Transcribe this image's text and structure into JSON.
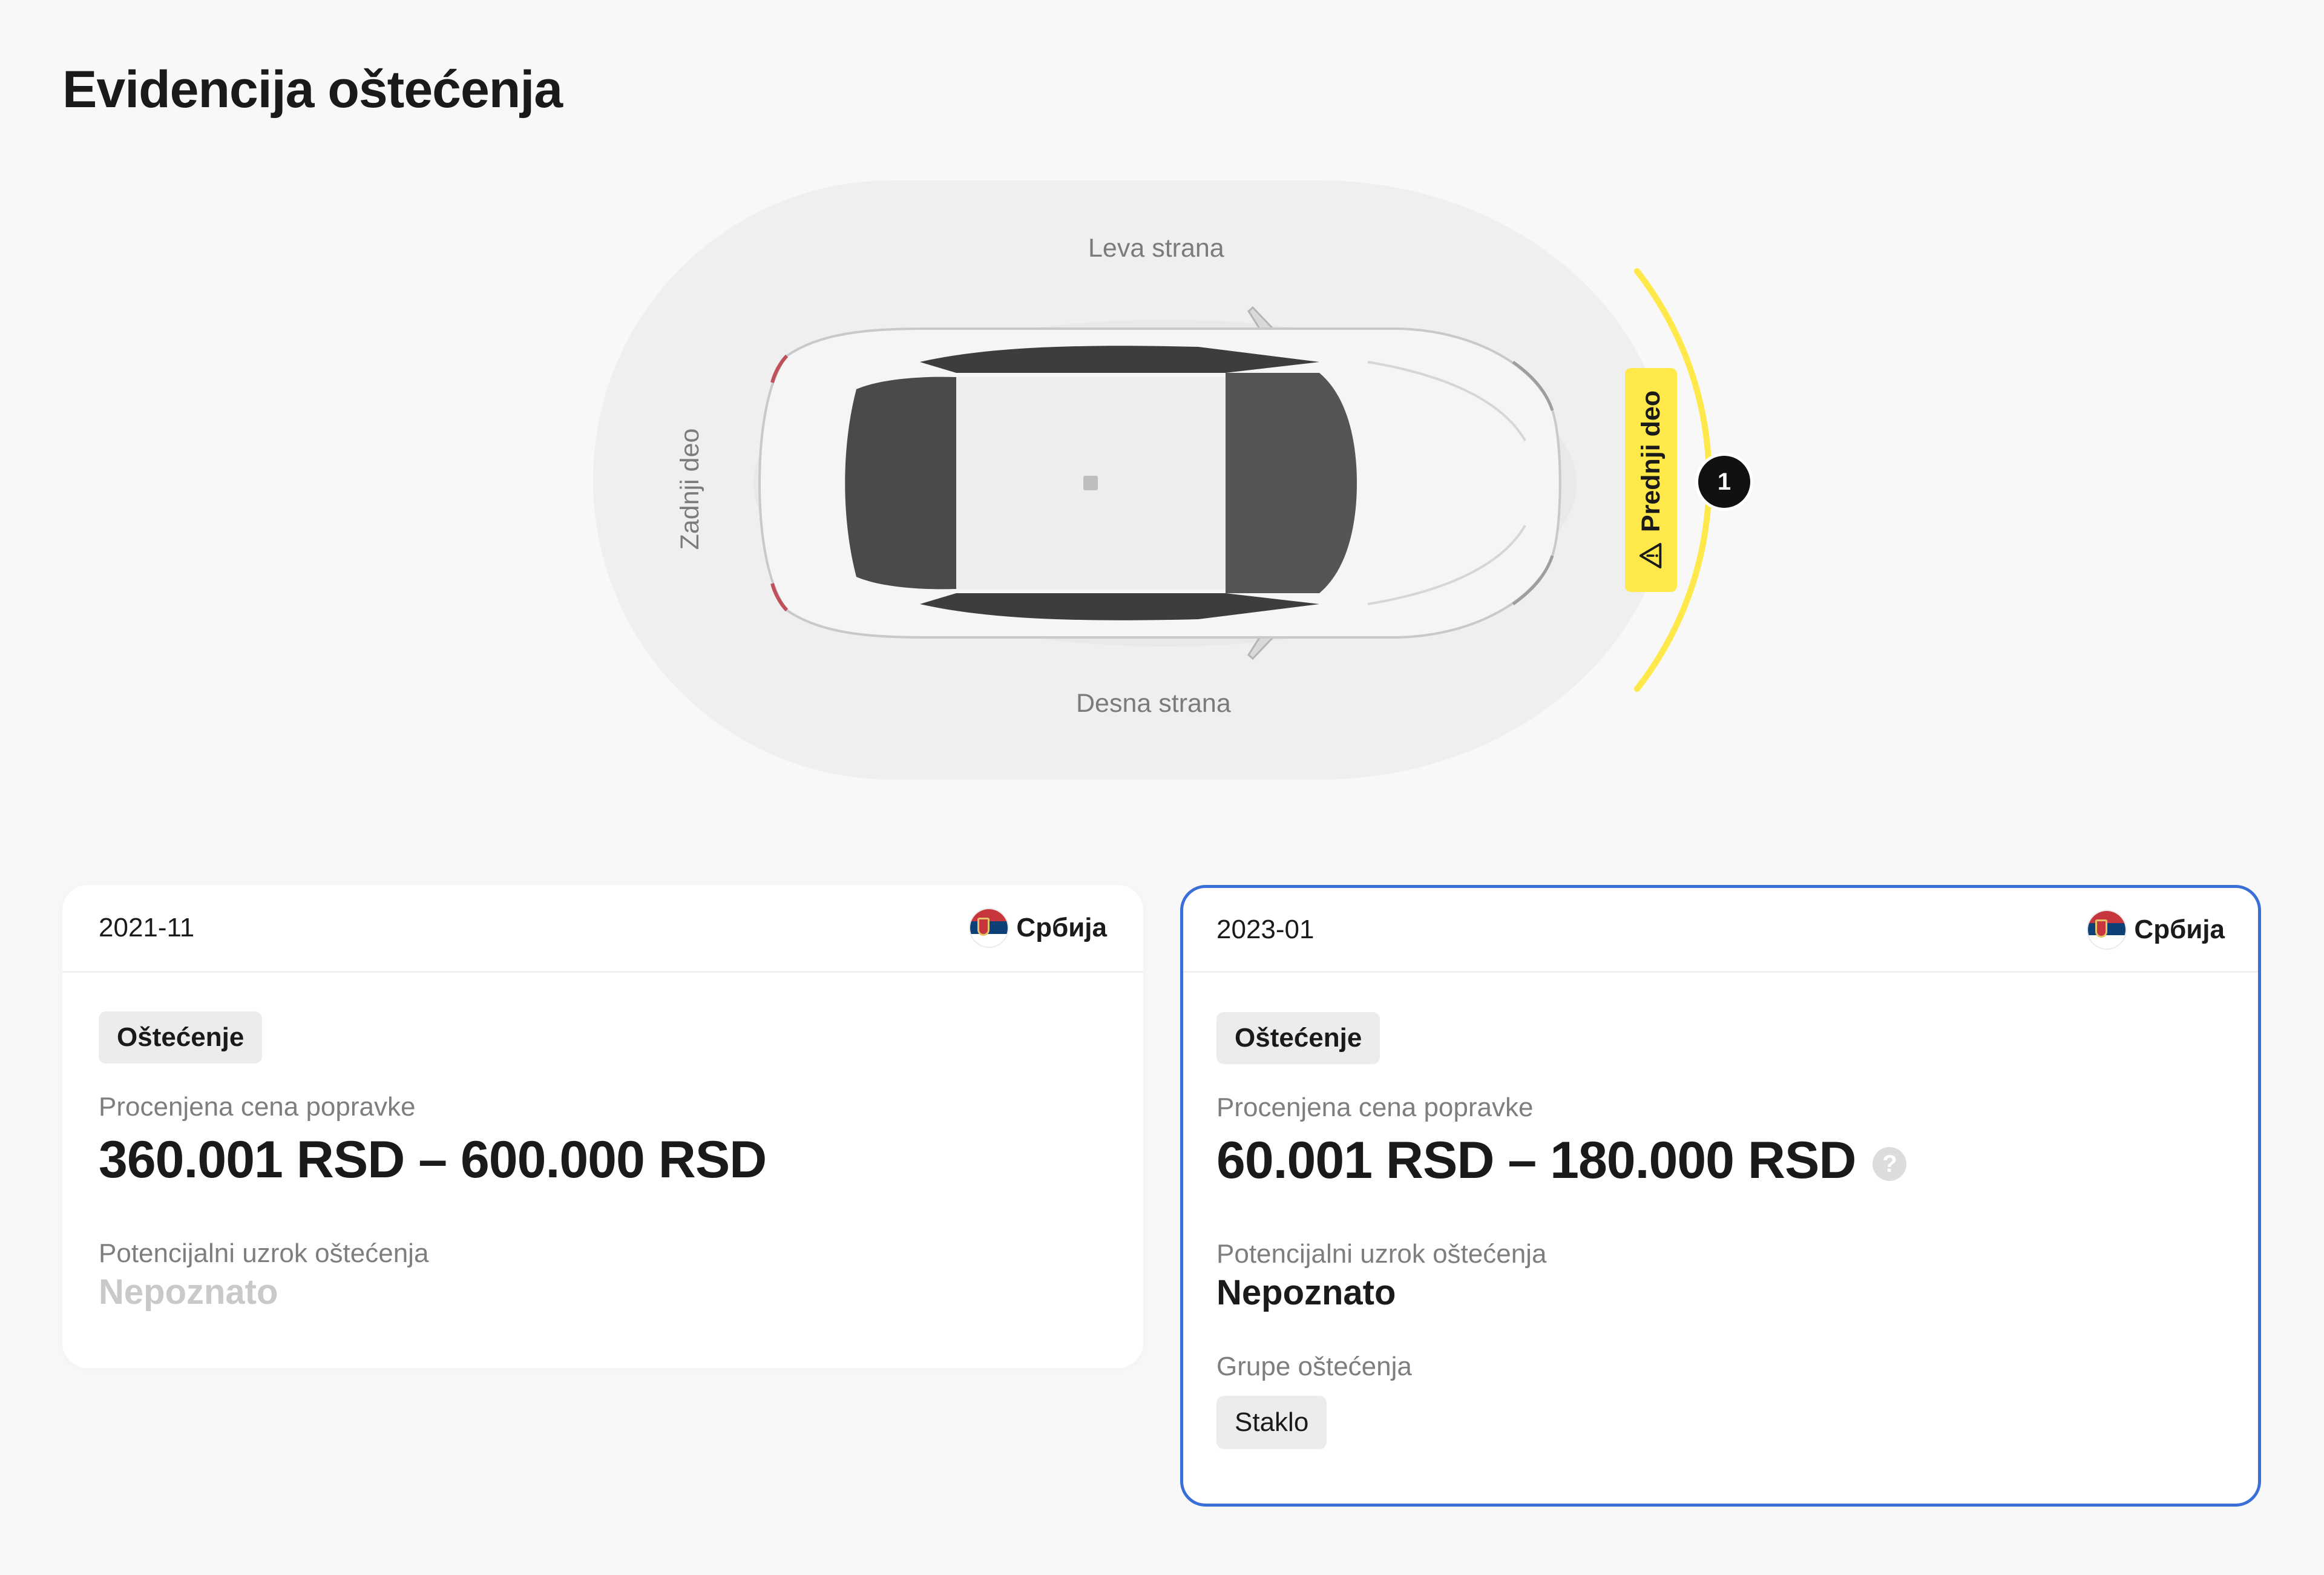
{
  "page": {
    "title": "Evidencija oštećenja"
  },
  "diagram": {
    "labels": {
      "left_side": "Leva strana",
      "right_side": "Desna strana",
      "rear": "Zadnji deo",
      "front": "Prednji deo"
    },
    "front_marker_count": "1",
    "highlight_color": "#ffe94a",
    "warning_icon": "warning-triangle-icon"
  },
  "records": [
    {
      "date": "2021-11",
      "country": "Србија",
      "flag_icon": "serbia-flag-icon",
      "tag": "Oštećenje",
      "price_label": "Procenjena cena popravke",
      "price": "360.001 RSD – 600.000 RSD",
      "cause_label": "Potencijalni uzrok oštećenja",
      "cause": "Nepoznato"
    },
    {
      "date": "2023-01",
      "country": "Србија",
      "flag_icon": "serbia-flag-icon",
      "tag": "Oštećenje",
      "price_label": "Procenjena cena popravke",
      "price": "60.001 RSD – 180.000 RSD",
      "help_icon": "help-question-icon",
      "help_glyph": "?",
      "cause_label": "Potencijalni uzrok oštećenja",
      "cause": "Nepoznato",
      "groups_label": "Grupe oštećenja",
      "groups": [
        "Staklo"
      ],
      "selected": true
    }
  ],
  "colors": {
    "selected_border": "#3a6fd8",
    "accent_yellow": "#ffe94a",
    "muted_text": "#7e7e7e"
  }
}
